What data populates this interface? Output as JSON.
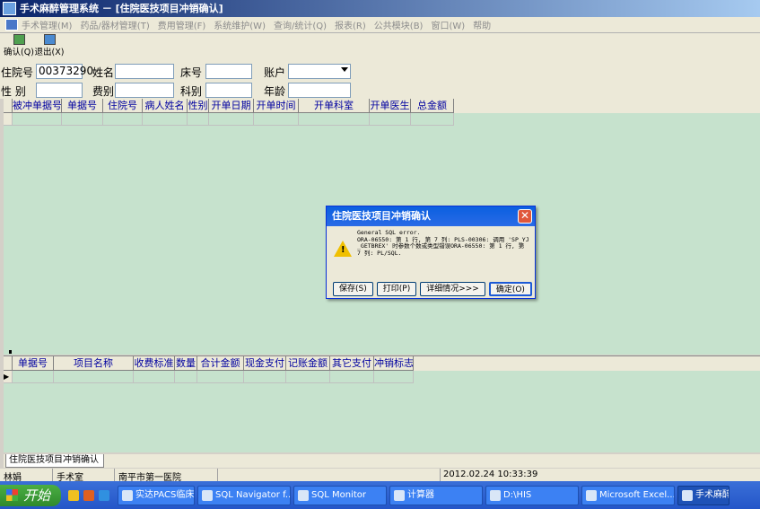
{
  "window": {
    "title": "手术麻醉管理系统 － [住院医技项目冲销确认]"
  },
  "menu": [
    "手术管理(M)",
    "药品/器材管理(T)",
    "费用管理(F)",
    "系统维护(W)",
    "查询/统计(Q)",
    "报表(R)",
    "公共模块(B)",
    "窗口(W)",
    "帮助"
  ],
  "toolbar": {
    "confirm": "确认(Q)",
    "exit": "退出(X)"
  },
  "form": {
    "inpatient_no_label": "住院号",
    "inpatient_no": "00373290",
    "name_label": "姓名",
    "bed_label": "床号",
    "account_label": "账户",
    "gender_label": "性 别",
    "fee_label": "费别",
    "dept_label": "科别",
    "age_label": "年龄"
  },
  "grid1": {
    "columns": [
      "被冲单据号",
      "单据号",
      "住院号",
      "病人姓名",
      "性别",
      "开单日期",
      "开单时间",
      "开单科室",
      "开单医生",
      "总金额"
    ]
  },
  "grid2": {
    "columns": [
      "单据号",
      "项目名称",
      "收费标准",
      "数量",
      "合计金额",
      "现金支付",
      "记账金额",
      "其它支付",
      "冲销标志"
    ]
  },
  "tab": {
    "label": "住院医技项目冲销确认"
  },
  "status": {
    "user": "林娟",
    "dept": "手术室",
    "hospital": "南平市第一医院",
    "datetime": "2012.02.24 10:33:39"
  },
  "dialog": {
    "title": "住院医技项目冲销确认",
    "message": "General SQL error.\nORA-06550: 第 1 行, 第 7 列: PLS-00306: 调用 'SP_YJ_GETBREX' 时参数个数或类型错误ORA-06550: 第 1 行, 第 7 列: PL/SQL.",
    "buttons": {
      "save": "保存(S)",
      "print": "打印(P)",
      "details": "详细情况>>>",
      "ok": "确定(O)"
    }
  },
  "taskbar": {
    "start": "开始",
    "items": [
      "实达PACS临床调...",
      "SQL Navigator f...",
      "SQL Monitor",
      "计算器",
      "D:\\HIS",
      "Microsoft Excel...",
      "手术麻醉管理"
    ]
  }
}
